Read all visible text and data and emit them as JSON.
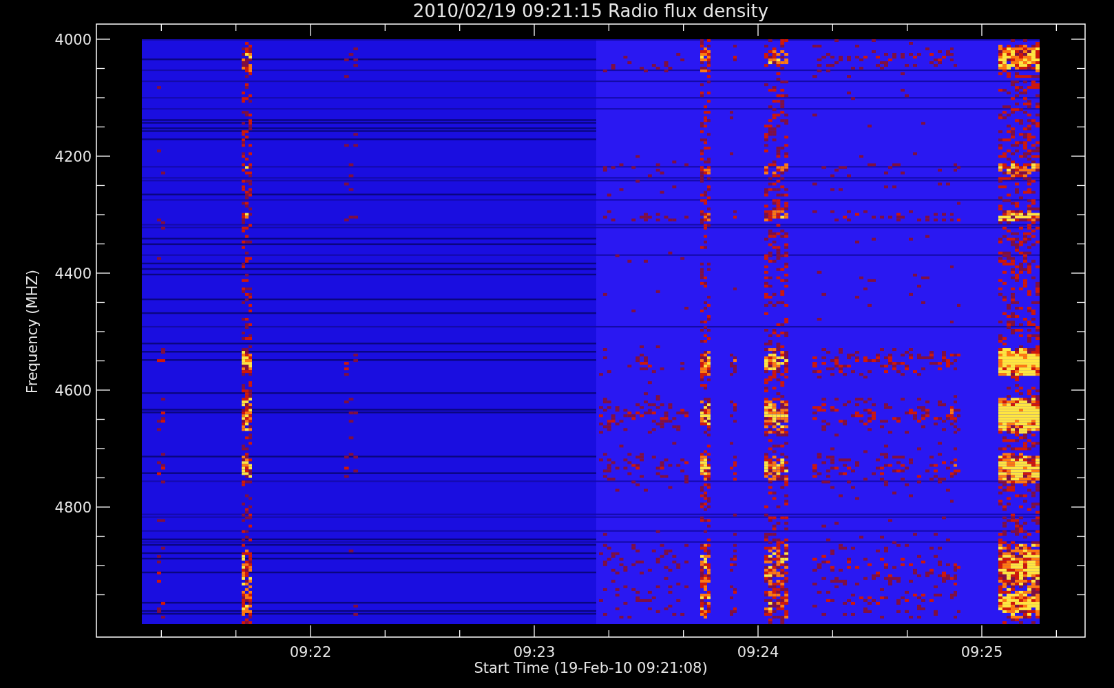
{
  "plot": {
    "title": "2010/02/19 09:21:15 Radio flux density",
    "y_axis": {
      "label": "Frequency (MHZ)",
      "ticks": [
        "4000",
        "4200",
        "4400",
        "4600",
        "4800"
      ]
    },
    "x_axis": {
      "label": "Start Time (19-Feb-10 09:21:08)",
      "ticks": [
        "09:22",
        "09:23",
        "09:24",
        "09:25"
      ]
    }
  }
}
